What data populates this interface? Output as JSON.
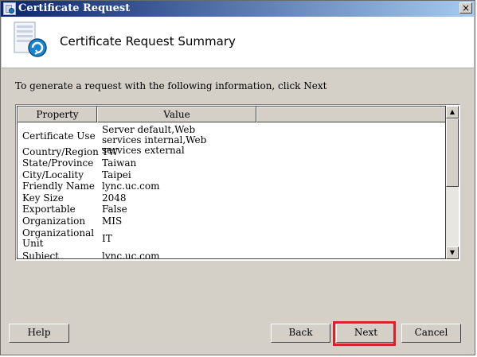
{
  "window": {
    "title": "Certificate Request",
    "close_glyph": "×"
  },
  "header": {
    "title": "Certificate Request Summary",
    "icon": "certificate-icon"
  },
  "instructions": "To generate a request with the following information, click Next",
  "table": {
    "columns": [
      "Property",
      "Value",
      ""
    ],
    "rows": [
      {
        "property": "Certificate Use",
        "value": "Server default,Web services internal,Web services external"
      },
      {
        "property": "Country/Region",
        "value": "TW"
      },
      {
        "property": "State/Province",
        "value": "Taiwan"
      },
      {
        "property": "City/Locality",
        "value": "Taipei"
      },
      {
        "property": "Friendly Name",
        "value": "lync.uc.com"
      },
      {
        "property": "Key Size",
        "value": "2048"
      },
      {
        "property": "Exportable",
        "value": "False"
      },
      {
        "property": "Organization",
        "value": "MIS"
      },
      {
        "property": "Organizational Unit",
        "value": "IT"
      },
      {
        "property": "Subject Name(SN)",
        "value": "lync.uc.com"
      }
    ]
  },
  "scrollbar": {
    "up_glyph": "▲",
    "down_glyph": "▼"
  },
  "buttons": {
    "help": "Help",
    "back": "Back",
    "next": "Next",
    "cancel": "Cancel"
  },
  "colors": {
    "highlight": "#d9202a",
    "title_bar": "#0a246a"
  }
}
